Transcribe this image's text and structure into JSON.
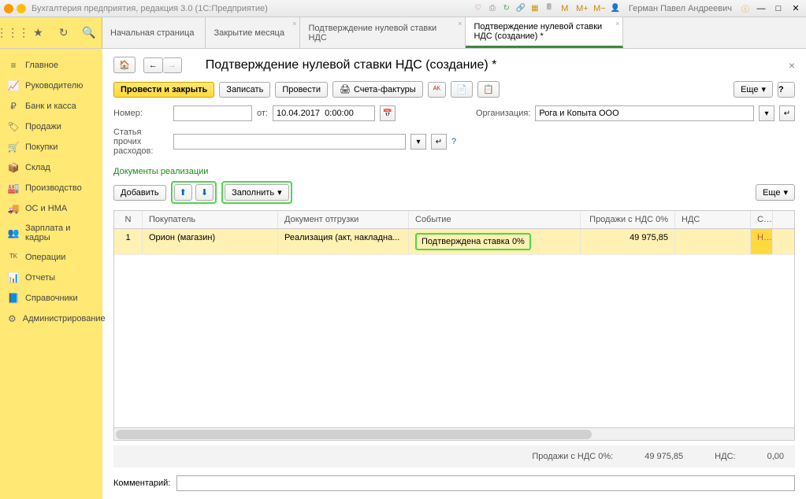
{
  "titlebar": {
    "app_title": "Бухгалтерия предприятия, редакция 3.0  (1С:Предприятие)",
    "user": "Герман Павел Андреевич",
    "m_labels": [
      "M",
      "M+",
      "M−"
    ]
  },
  "tabs": {
    "t1": "Начальная страница",
    "t2": "Закрытие месяца",
    "t3": "Подтверждение нулевой ставки НДС",
    "t4": "Подтверждение нулевой ставки НДС (создание) *"
  },
  "sidebar": {
    "items": [
      {
        "icon": "menu",
        "label": "Главное"
      },
      {
        "icon": "chart",
        "label": "Руководителю"
      },
      {
        "icon": "ruble",
        "label": "Банк и касса"
      },
      {
        "icon": "tag",
        "label": "Продажи"
      },
      {
        "icon": "cart",
        "label": "Покупки"
      },
      {
        "icon": "box",
        "label": "Склад"
      },
      {
        "icon": "factory",
        "label": "Производство"
      },
      {
        "icon": "truck",
        "label": "ОС и НМА"
      },
      {
        "icon": "people",
        "label": "Зарплата и кадры"
      },
      {
        "icon": "ops",
        "label": "Операции"
      },
      {
        "icon": "report",
        "label": "Отчеты"
      },
      {
        "icon": "book",
        "label": "Справочники"
      },
      {
        "icon": "gear",
        "label": "Администрирование"
      }
    ]
  },
  "page": {
    "title": "Подтверждение нулевой ставки НДС (создание) *",
    "buttons": {
      "post_close": "Провести и закрыть",
      "save": "Записать",
      "post": "Провести",
      "invoices": "Счета-фактуры",
      "more": "Еще",
      "ask": "?"
    },
    "form": {
      "number_label": "Номер:",
      "number_value": "",
      "from_label": "от:",
      "date_value": "10.04.2017  0:00:00",
      "org_label": "Организация:",
      "org_value": "Рога и Копыта ООО",
      "expense_label": "Статья прочих расходов:",
      "expense_value": ""
    },
    "section_title": "Документы реализации",
    "subtoolbar": {
      "add": "Добавить",
      "fill": "Заполнить",
      "more2": "Еще"
    },
    "table": {
      "headers": {
        "n": "N",
        "buyer": "Покупатель",
        "doc": "Документ отгрузки",
        "event": "Событие",
        "sales": "Продажи с НДС 0%",
        "nds": "НДС",
        "s": "С..."
      },
      "rows": [
        {
          "n": "1",
          "buyer": "Орион (магазин)",
          "doc": "Реализация (акт, накладна...",
          "event": "Подтверждена ставка 0%",
          "sales": "49 975,85",
          "nds": "",
          "s": "Н..."
        }
      ]
    },
    "sums": {
      "sales_label": "Продажи с НДС 0%:",
      "sales_value": "49 975,85",
      "nds_label": "НДС:",
      "nds_value": "0,00"
    },
    "comment_label": "Комментарий:",
    "comment_value": ""
  }
}
